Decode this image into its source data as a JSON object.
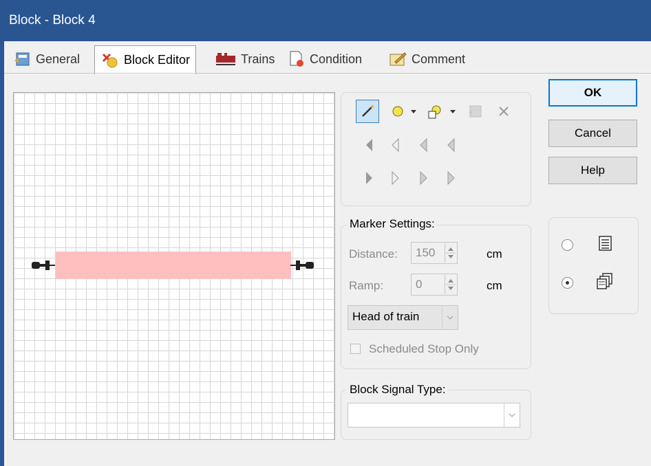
{
  "window": {
    "title": "Block - Block 4"
  },
  "tabs": [
    {
      "label": "General",
      "icon": "general-properties-icon"
    },
    {
      "label": "Block Editor",
      "icon": "block-editor-icon",
      "active": true
    },
    {
      "label": "Trains",
      "icon": "trains-icon"
    },
    {
      "label": "Condition",
      "icon": "condition-icon"
    },
    {
      "label": "Comment",
      "icon": "comment-icon"
    }
  ],
  "toolbar": {
    "tools": [
      "pencil-icon",
      "circle-marker-icon",
      "dropdown-arrow-icon",
      "shape-tool-icon",
      "dropdown-arrow-icon",
      "properties-icon",
      "delete-icon"
    ],
    "left_arrows": [
      "arrow-left-icon",
      "arrow-left-icon",
      "arrow-left-icon",
      "arrow-left-icon"
    ],
    "right_arrows": [
      "arrow-right-icon",
      "arrow-right-icon",
      "arrow-right-icon",
      "arrow-right-icon"
    ]
  },
  "marker_settings": {
    "legend": "Marker Settings:",
    "distance_label": "Distance:",
    "distance_value": "150",
    "distance_unit": "cm",
    "ramp_label": "Ramp:",
    "ramp_value": "0",
    "ramp_unit": "cm",
    "position_selected": "Head of train",
    "scheduled_label": "Scheduled Stop Only"
  },
  "signal": {
    "legend": "Block Signal Type:",
    "value": ""
  },
  "buttons": {
    "ok": "OK",
    "cancel": "Cancel",
    "help": "Help"
  },
  "view_mode": {
    "options": [
      "list-view-icon",
      "multi-view-icon"
    ],
    "selected": 1
  },
  "colors": {
    "titlebar": "#295591",
    "block": "#ffbfbf",
    "accent": "#0078d7"
  }
}
